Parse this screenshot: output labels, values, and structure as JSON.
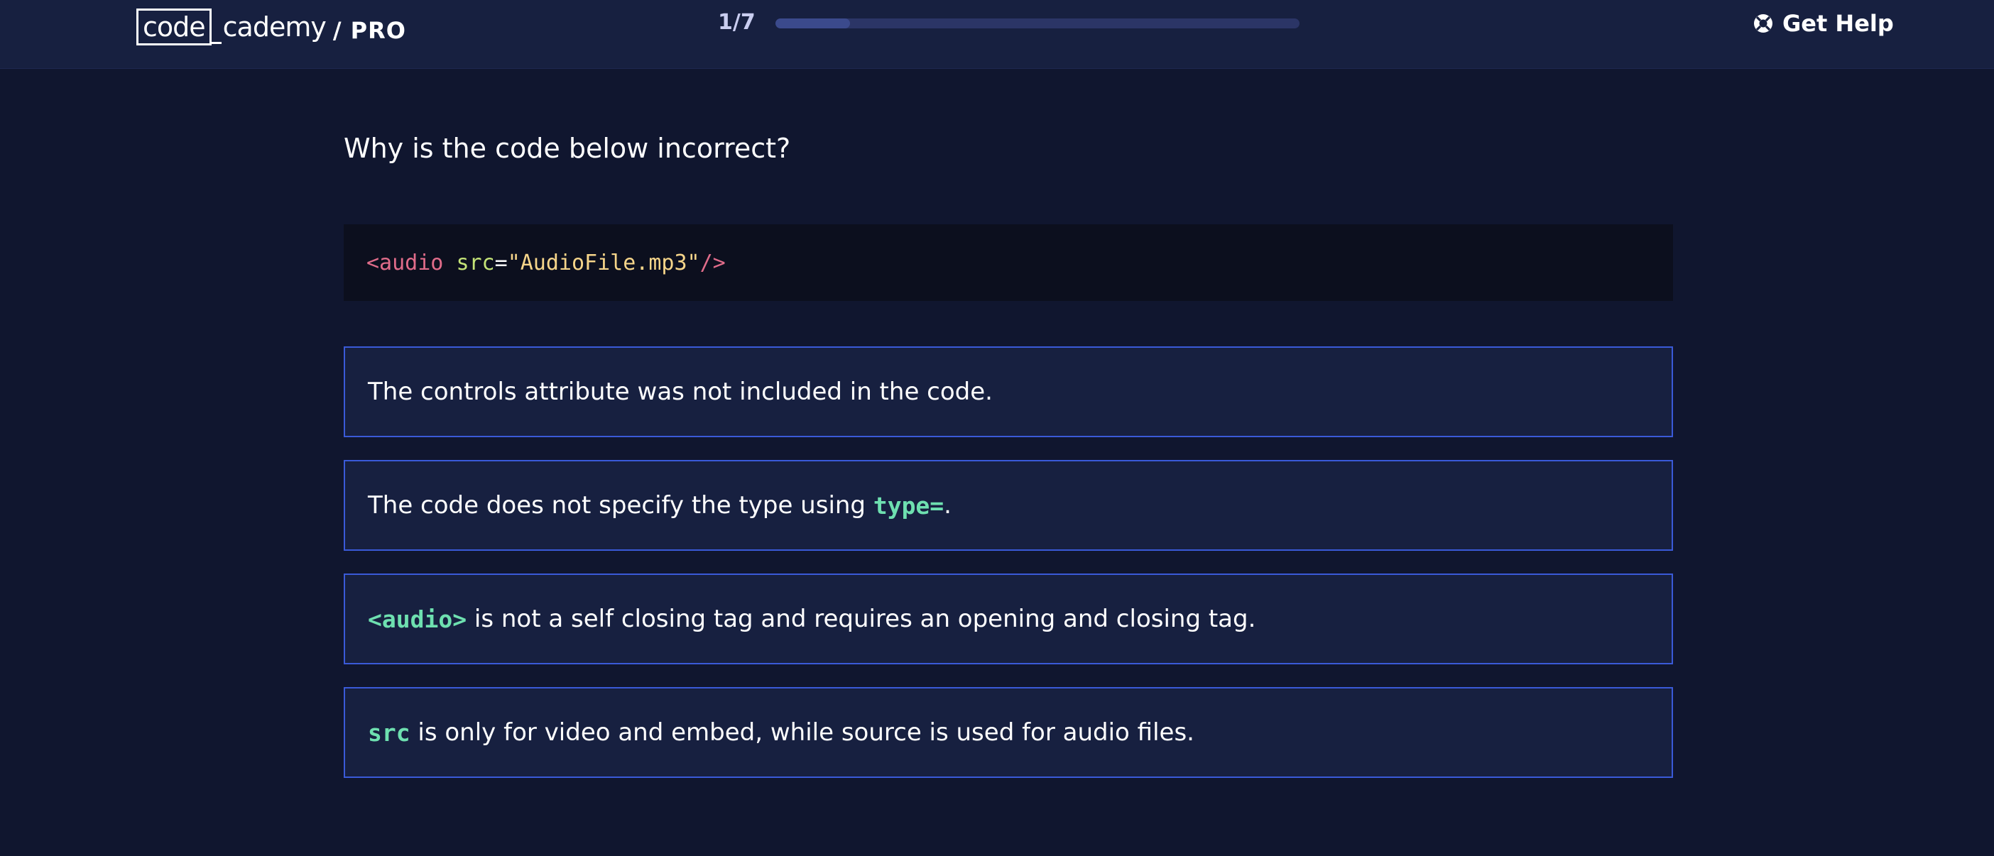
{
  "header": {
    "logo": {
      "box_text": "code",
      "rest_text": "cademy",
      "pro_text": "/ PRO"
    },
    "progress": {
      "label": "1/7",
      "fraction": 0.1429
    },
    "help": {
      "label": "Get Help",
      "icon": "lifebuoy-icon"
    }
  },
  "quiz": {
    "question": "Why is the code below incorrect?",
    "code_tokens": {
      "open": "<audio",
      "attr": "src",
      "eq": "=",
      "value": "\"AudioFile.mp3\"",
      "close": "/>"
    },
    "answers": [
      {
        "prefix_code": "",
        "text": "The controls attribute was not included in the code.",
        "suffix_code": "",
        "tail": ""
      },
      {
        "prefix_code": "",
        "text": "The code does not specify the type using ",
        "suffix_code": "type=",
        "tail": "."
      },
      {
        "prefix_code": "<audio>",
        "text": " is not a self closing tag and requires an opening and closing tag.",
        "suffix_code": "",
        "tail": ""
      },
      {
        "prefix_code": "src",
        "text": " is only for video and embed, while source is used for audio files.",
        "suffix_code": "",
        "tail": ""
      }
    ]
  },
  "colors": {
    "background": "#10162f",
    "header": "#172040",
    "answer_border": "#3a5ad8",
    "code_highlight": "#6ee0b0"
  }
}
